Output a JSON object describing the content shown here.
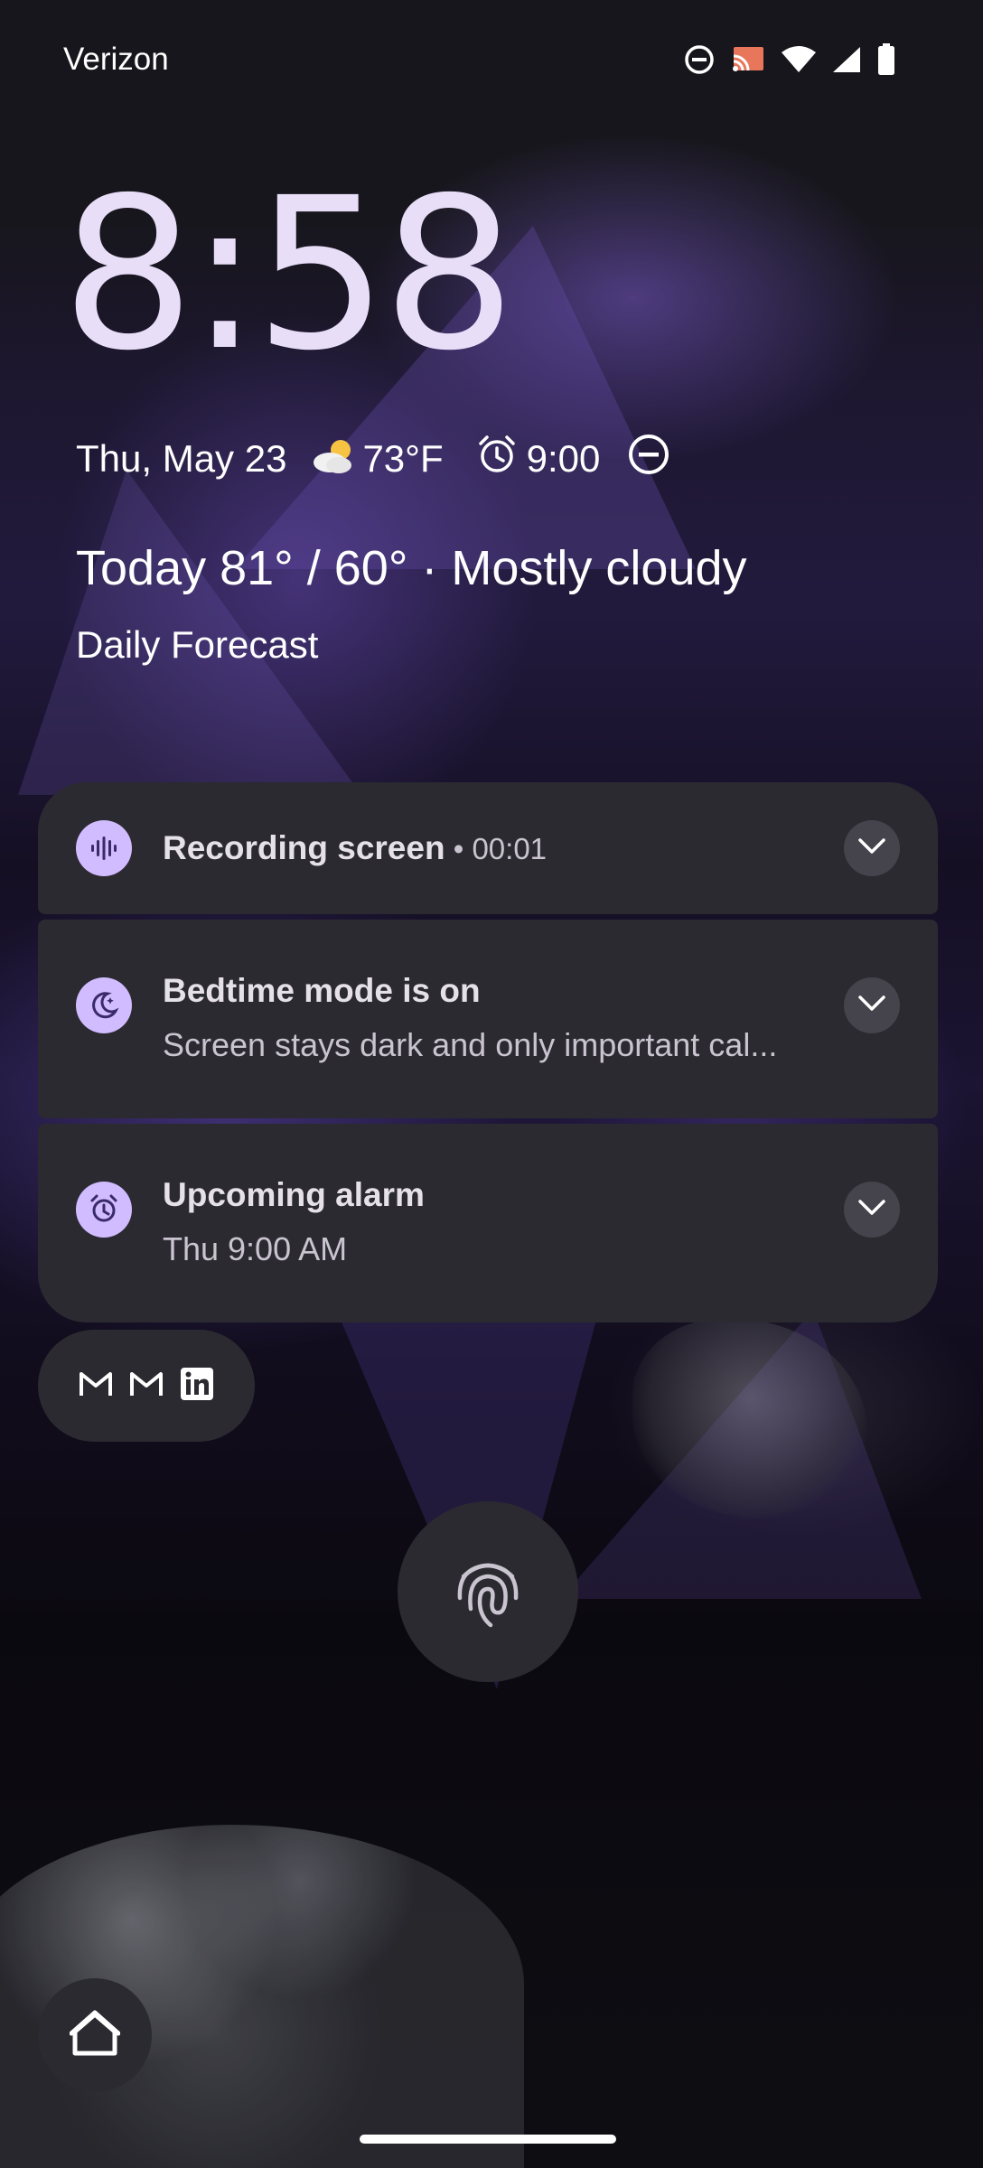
{
  "status_bar": {
    "carrier": "Verizon",
    "icons": [
      "do-not-disturb-icon",
      "cast-icon",
      "wifi-icon",
      "cell-signal-icon",
      "battery-icon"
    ]
  },
  "lockscreen": {
    "clock": "8:58",
    "date": "Thu, May 23",
    "weather_icon": "partly-cloudy-icon",
    "temperature": "73°F",
    "alarm_time": "9:00",
    "forecast_headline": "Today 81° / 60° · Mostly cloudy",
    "forecast_sub": "Daily Forecast"
  },
  "notifications": [
    {
      "icon": "screen-record-icon",
      "title": "Recording screen",
      "time": " • 00:01",
      "text": ""
    },
    {
      "icon": "bedtime-moon-icon",
      "title": "Bedtime mode is on",
      "text": "Screen stays dark and only important cal..."
    },
    {
      "icon": "alarm-clock-icon",
      "title": "Upcoming alarm",
      "text": "Thu 9:00 AM"
    }
  ],
  "app_icons": [
    "gmail-icon",
    "gmail-icon",
    "linkedin-icon"
  ],
  "colors": {
    "accent": "#d0bcff",
    "clock": "#e8def8",
    "card": "#2b2a31"
  }
}
